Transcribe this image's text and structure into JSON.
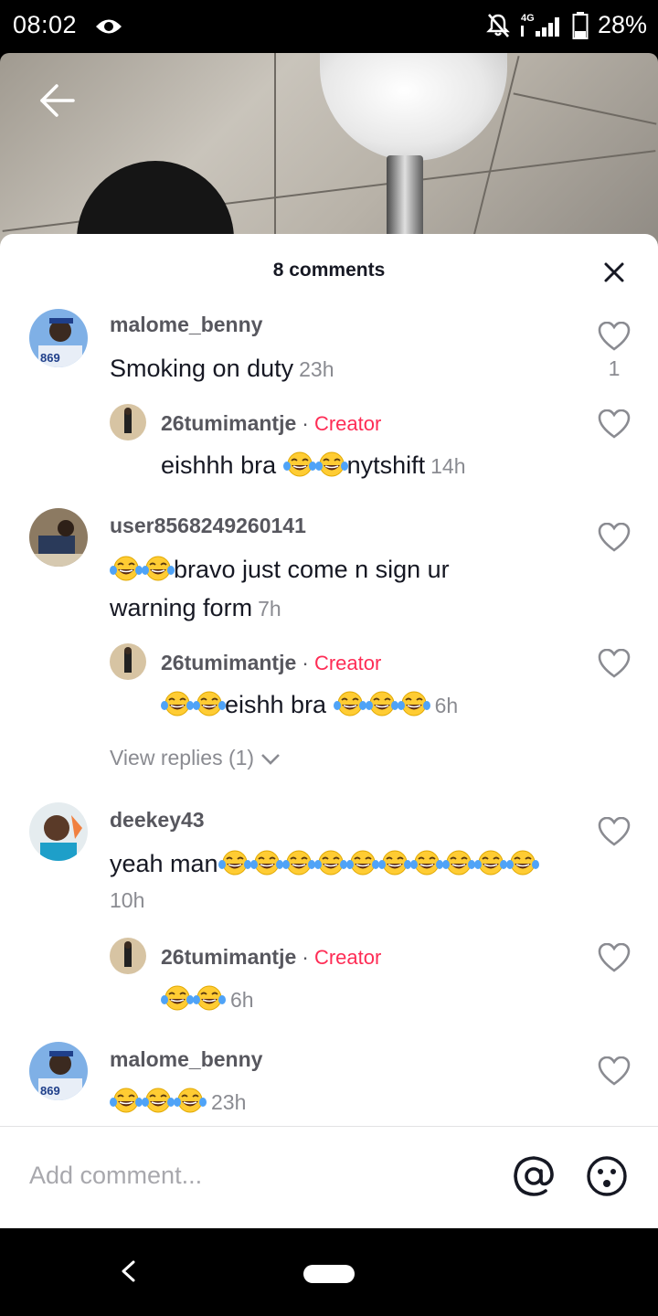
{
  "status_bar": {
    "time": "08:02",
    "network": "4G",
    "battery": "28%"
  },
  "sheet": {
    "title": "8 comments",
    "close_icon": "close-icon"
  },
  "comments": [
    {
      "username": "malome_benny",
      "text": "Smoking on duty",
      "time": "23h",
      "likes": "1"
    },
    {
      "username": "26tumimantje",
      "badge": "Creator",
      "text_before": "eishhh bra ",
      "emoji_count_mid": 2,
      "text_after": "nytshift",
      "time": "14h"
    },
    {
      "username": "user8568249260141",
      "emoji_count_lead": 2,
      "text": "bravo just come n sign ur warning form",
      "time": "7h"
    },
    {
      "username": "26tumimantje",
      "badge": "Creator",
      "emoji_count_lead": 2,
      "text": "eishh bra ",
      "emoji_count_trail": 3,
      "time": "6h"
    },
    {
      "username": "deekey43",
      "text": "yeah man",
      "emoji_count_trail": 10,
      "time": "10h"
    },
    {
      "username": "26tumimantje",
      "badge": "Creator",
      "emoji_count_lead": 2,
      "time": "6h"
    },
    {
      "username": "malome_benny",
      "emoji_count_lead": 3,
      "time": "23h"
    }
  ],
  "view_replies": "View replies (1)",
  "input": {
    "placeholder": "Add comment..."
  },
  "colors": {
    "creator_badge": "#fe2c55",
    "muted_text": "#8a8b91",
    "username": "#57575e"
  }
}
